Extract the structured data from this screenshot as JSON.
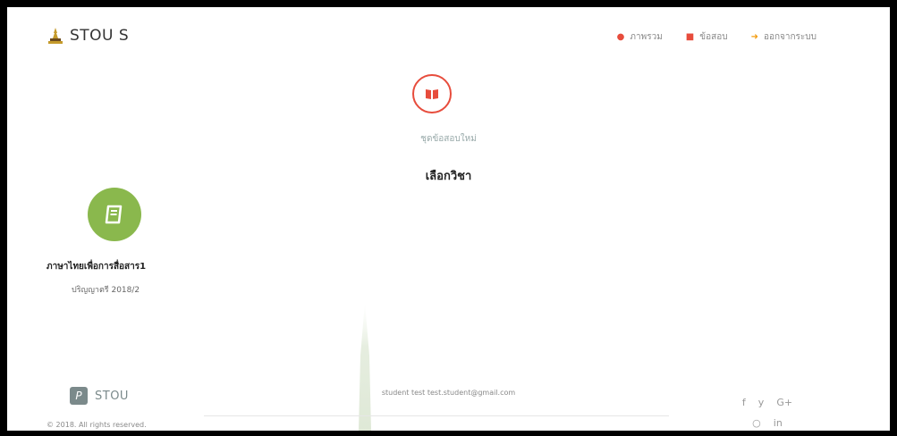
{
  "brand": {
    "name": "STOU S"
  },
  "nav": [
    {
      "label": "ภาพรวม",
      "icon": "gauge-icon"
    },
    {
      "label": "ข้อสอบ",
      "icon": "file-icon"
    },
    {
      "label": "ออกจากระบบ",
      "icon": "sign-out-icon"
    }
  ],
  "hero": {
    "caption": "ชุดข้อสอบใหม่",
    "heading": "เลือกวิชา"
  },
  "course": {
    "title": "ภาษาไทยเพื่อการสื่อสาร1",
    "subtitle": "ปริญญาตรี 2018/2"
  },
  "footer": {
    "logo_letter": "P",
    "logo_text": "STOU",
    "copyright": "© 2018. All rights reserved.",
    "user": "student test test.student@gmail.com",
    "social": [
      "f",
      "y",
      "G+",
      "○",
      "in"
    ]
  },
  "colors": {
    "accent_red": "#e74c3c",
    "course_green": "#8ab84d",
    "nav_orange": "#f39c12"
  }
}
